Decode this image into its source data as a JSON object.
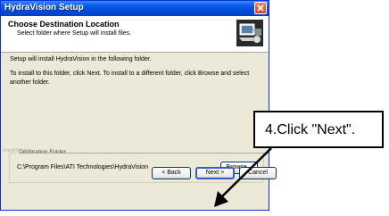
{
  "window": {
    "title": "HydraVision Setup"
  },
  "header": {
    "title": "Choose Destination Location",
    "subtitle": "Select folder where Setup will install files."
  },
  "content": {
    "line1": "Setup will install HydraVision in the following folder.",
    "line2": "To install to this folder, click Next. To install to a different folder, click Browse and select another folder."
  },
  "destination": {
    "legend": "Destination Folder",
    "path": "C:\\Program Files\\ATI Technologies\\HydraVision",
    "browse_label": "Browse..."
  },
  "footer": {
    "brand": "InstallShield",
    "back_label": "< Back",
    "next_label": "Next >",
    "cancel_label": "Cancel"
  },
  "callout": {
    "text": "4.Click \"Next\"."
  },
  "icons": {
    "close": "close-icon",
    "setup": "computer-setup-icon"
  }
}
